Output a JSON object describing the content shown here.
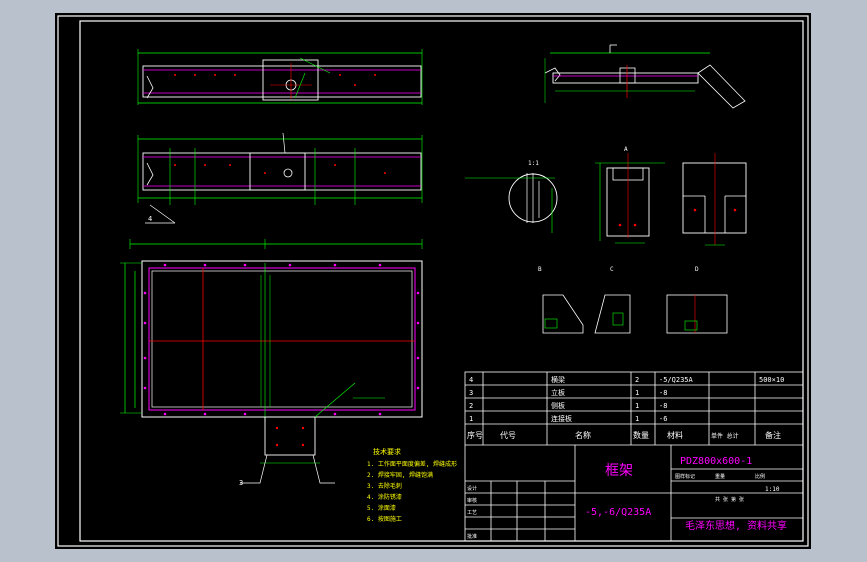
{
  "viewport": {
    "background": "#b9c1cc",
    "sheet_color": "#000000"
  },
  "colors": {
    "frame": "#ffffff",
    "dim": "#00ff00",
    "part": "#ff00ff",
    "center": "#ff0000",
    "note": "#ffff00",
    "text": "#ffffff"
  },
  "drawing": {
    "top_view_label": "3",
    "side_view_label": "4",
    "section_view_label": "A",
    "detail_label": "1:1",
    "view_marks": [
      "B",
      "C",
      "D"
    ]
  },
  "tech_notes": {
    "heading": "技术要求",
    "items": [
      "1. 工作面平面度偏差, 焊缝成形",
      "2. 焊接牢固, 焊缝饱满",
      "3. 去除毛刺",
      "4. 涂防锈漆",
      "5. 涂面漆",
      "6. 按图施工"
    ]
  },
  "title_block": {
    "bom_rows": [
      {
        "no": "4",
        "code": "",
        "name": "横梁",
        "qty": "2",
        "material": "-5/Q235A",
        "weight": "",
        "remark": "500×10"
      },
      {
        "no": "3",
        "code": "",
        "name": "立板",
        "qty": "1",
        "material": "-8",
        "weight": "",
        "remark": ""
      },
      {
        "no": "2",
        "code": "",
        "name": "侧板",
        "qty": "1",
        "material": "-8",
        "weight": "",
        "remark": ""
      },
      {
        "no": "1",
        "code": "",
        "name": "连接板",
        "qty": "1",
        "material": "-6",
        "weight": "",
        "remark": ""
      }
    ],
    "bom_header": {
      "no": "序号",
      "code": "代号",
      "name": "名称",
      "qty": "数量",
      "material": "材料",
      "weight": "单件 总计",
      "remark": "备注"
    },
    "part_name": "框架",
    "drawing_number": "PDZ800x600-1",
    "material_spec": "-5,-6/Q235A",
    "scale": "1:10",
    "company": "毛泽东思想, 资料共享",
    "rows_labels": [
      "标记",
      "处数",
      "分区",
      "更改文件号",
      "签名",
      "年月日"
    ],
    "sign_labels": [
      "设计",
      "审核",
      "工艺",
      "批准"
    ],
    "stage_labels": [
      "图样标记",
      "重量",
      "比例"
    ],
    "sheet_label": "共 张 第 张"
  }
}
